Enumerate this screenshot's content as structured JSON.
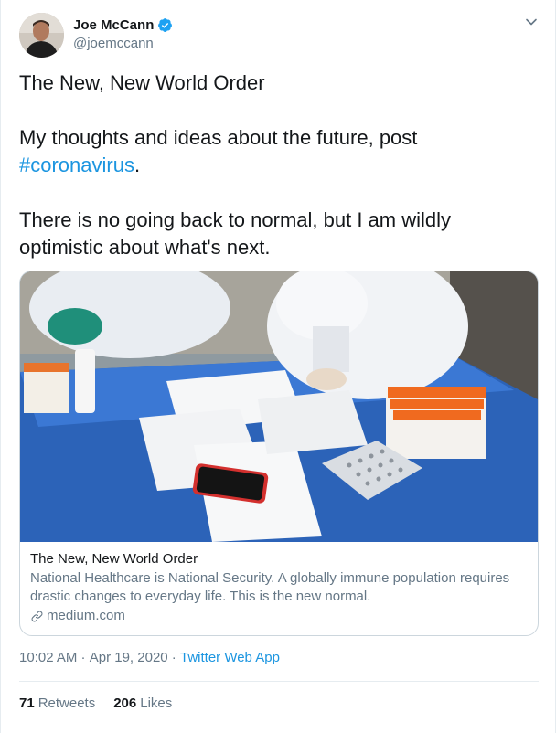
{
  "author": {
    "display_name": "Joe McCann",
    "handle": "@joemccann",
    "verified_icon": "verified-badge-icon"
  },
  "tweet": {
    "line1": "The New, New World Order",
    "line2_prefix": "My thoughts and ideas about the future, post ",
    "hashtag": "#coronavirus",
    "line2_suffix": ".",
    "line3": "There is no going back to normal, but I am wildly optimistic about what's next."
  },
  "card": {
    "title": "The New, New World Order",
    "description": "National Healthcare is National Security. A globally immune population requires drastic changes to everyday life. This is the new normal.",
    "url": "medium.com"
  },
  "meta": {
    "time": "10:02 AM",
    "sep1": " · ",
    "date": "Apr 19, 2020",
    "sep2": " · ",
    "source": "Twitter Web App"
  },
  "stats": {
    "retweets_count": "71",
    "retweets_label": "Retweets",
    "likes_count": "206",
    "likes_label": "Likes"
  },
  "colors": {
    "link": "#1b95e0",
    "secondary_text": "#657786",
    "border": "#ccd6dd"
  }
}
